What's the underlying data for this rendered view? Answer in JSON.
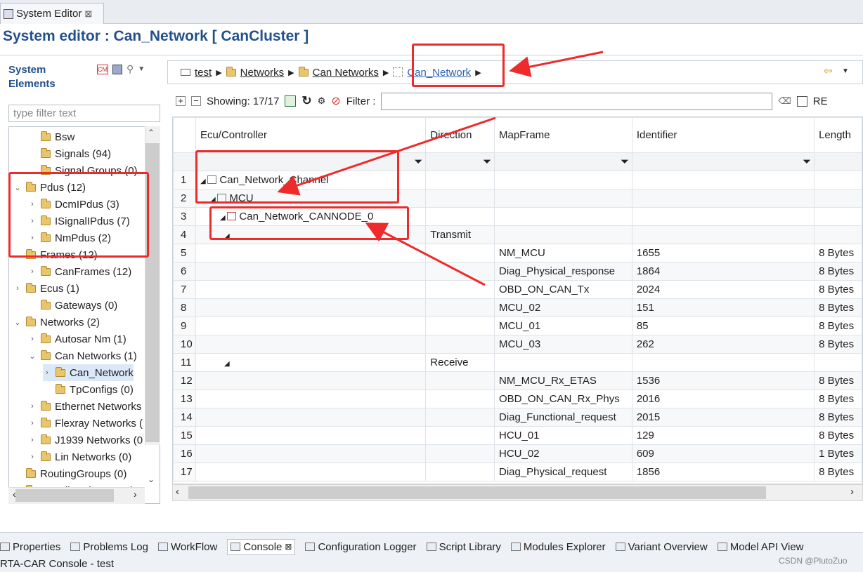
{
  "editor_tab": {
    "label": "System Editor",
    "close": "⊠"
  },
  "title": "System editor : Can_Network [ CanCluster ]",
  "left": {
    "label_line1": "System",
    "label_line2": "Elements",
    "filter_placeholder": "type filter text",
    "tree": [
      {
        "twisty": "",
        "label": "Bsw"
      },
      {
        "twisty": "",
        "label": "Signals (94)"
      },
      {
        "twisty": "",
        "label": "Signal Groups (0)"
      },
      {
        "twisty": "v",
        "label": "Pdus (12)"
      },
      {
        "twisty": ">",
        "label": "DcmIPdus (3)"
      },
      {
        "twisty": ">",
        "label": "ISignalIPdus (7)"
      },
      {
        "twisty": ">",
        "label": "NmPdus (2)"
      },
      {
        "twisty": "v",
        "label": "Frames (12)"
      },
      {
        "twisty": ">",
        "label": "CanFrames (12)"
      },
      {
        "twisty": ">",
        "label": "Ecus (1)"
      },
      {
        "twisty": "",
        "label": "Gateways (0)"
      },
      {
        "twisty": "v",
        "label": "Networks (2)"
      },
      {
        "twisty": ">",
        "label": "Autosar Nm (1)"
      },
      {
        "twisty": "v",
        "label": "Can Networks (1)"
      },
      {
        "twisty": ">",
        "label": "Can_Network"
      },
      {
        "twisty": "",
        "label": "TpConfigs (0)"
      },
      {
        "twisty": ">",
        "label": "Ethernet Networks"
      },
      {
        "twisty": ">",
        "label": "Flexray Networks ("
      },
      {
        "twisty": ">",
        "label": "J1939 Networks (0"
      },
      {
        "twisty": ">",
        "label": "Lin Networks (0)"
      },
      {
        "twisty": "",
        "label": "RoutingGroups (0)"
      },
      {
        "twisty": "",
        "label": "CouplingElements (0"
      }
    ]
  },
  "breadcrumb": [
    "test",
    "Networks",
    "Can Networks",
    "Can_Network"
  ],
  "toolbar": {
    "showing": "Showing: 17/17",
    "filter_label": "Filter :",
    "re_label": "RE"
  },
  "columns": [
    "",
    "Ecu/Controller",
    "Direction",
    "MapFrame",
    "Identifier",
    "Length"
  ],
  "rows": [
    {
      "n": "1",
      "ecu": "Can_Network_Channel",
      "dir": "",
      "frame": "",
      "id": "",
      "len": ""
    },
    {
      "n": "2",
      "ecu": "MCU",
      "dir": "",
      "frame": "",
      "id": "",
      "len": ""
    },
    {
      "n": "3",
      "ecu": "Can_Network_CANNODE_0",
      "dir": "",
      "frame": "",
      "id": "",
      "len": ""
    },
    {
      "n": "4",
      "ecu": "",
      "dir": "Transmit",
      "frame": "",
      "id": "",
      "len": ""
    },
    {
      "n": "5",
      "ecu": "",
      "dir": "",
      "frame": "NM_MCU",
      "id": "1655",
      "len": "8 Bytes"
    },
    {
      "n": "6",
      "ecu": "",
      "dir": "",
      "frame": "Diag_Physical_response",
      "id": "1864",
      "len": "8 Bytes"
    },
    {
      "n": "7",
      "ecu": "",
      "dir": "",
      "frame": "OBD_ON_CAN_Tx",
      "id": "2024",
      "len": "8 Bytes"
    },
    {
      "n": "8",
      "ecu": "",
      "dir": "",
      "frame": "MCU_02",
      "id": "151",
      "len": "8 Bytes"
    },
    {
      "n": "9",
      "ecu": "",
      "dir": "",
      "frame": "MCU_01",
      "id": "85",
      "len": "8 Bytes"
    },
    {
      "n": "10",
      "ecu": "",
      "dir": "",
      "frame": "MCU_03",
      "id": "262",
      "len": "8 Bytes"
    },
    {
      "n": "11",
      "ecu": "",
      "dir": "Receive",
      "frame": "",
      "id": "",
      "len": ""
    },
    {
      "n": "12",
      "ecu": "",
      "dir": "",
      "frame": "NM_MCU_Rx_ETAS",
      "id": "1536",
      "len": "8 Bytes"
    },
    {
      "n": "13",
      "ecu": "",
      "dir": "",
      "frame": "OBD_ON_CAN_Rx_Phys",
      "id": "2016",
      "len": "8 Bytes"
    },
    {
      "n": "14",
      "ecu": "",
      "dir": "",
      "frame": "Diag_Functional_request",
      "id": "2015",
      "len": "8 Bytes"
    },
    {
      "n": "15",
      "ecu": "",
      "dir": "",
      "frame": "HCU_01",
      "id": "129",
      "len": "8 Bytes"
    },
    {
      "n": "16",
      "ecu": "",
      "dir": "",
      "frame": "HCU_02",
      "id": "609",
      "len": "1 Bytes"
    },
    {
      "n": "17",
      "ecu": "",
      "dir": "",
      "frame": "Diag_Physical_request",
      "id": "1856",
      "len": "8 Bytes"
    }
  ],
  "bottom_tabs": [
    "Properties",
    "Problems Log",
    "WorkFlow",
    "Console",
    "Configuration Logger",
    "Script Library",
    "Modules Explorer",
    "Variant Overview",
    "Model API View"
  ],
  "console_line": "RTA-CAR Console - test",
  "watermark": "CSDN @PlutoZuo",
  "colors": {
    "accent": "#23508c",
    "annotation": "#ee2a2a"
  }
}
